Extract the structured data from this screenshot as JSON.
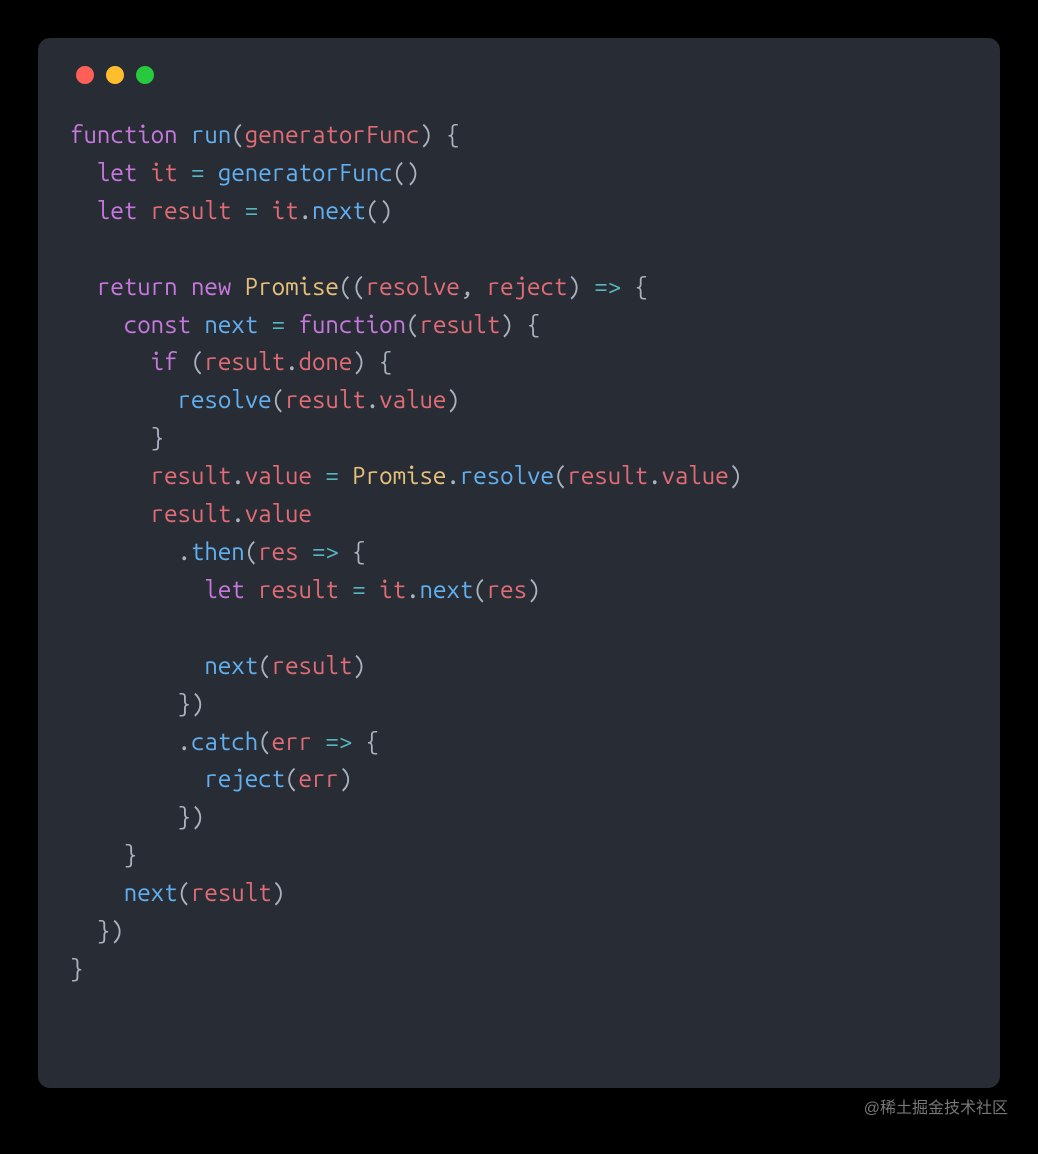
{
  "code": {
    "tokens": [
      [
        [
          "kw",
          "function"
        ],
        [
          "",
          ""
        ],
        [
          "",
          ""
        ],
        [
          "",
          ""
        ],
        [
          "",
          ""
        ],
        [
          "",
          ""
        ],
        [
          "",
          ""
        ],
        [
          "",
          ""
        ],
        [
          "",
          ""
        ],
        [
          "",
          ""
        ]
      ],
      []
    ],
    "raw_lines": [
      {
        "indent": 0,
        "segs": [
          [
            "kw",
            "function "
          ],
          [
            "fn",
            "run"
          ],
          [
            "punc",
            "("
          ],
          [
            "param",
            "generatorFunc"
          ],
          [
            "punc",
            ") {"
          ]
        ]
      },
      {
        "indent": 1,
        "segs": [
          [
            "kw",
            "let "
          ],
          [
            "var",
            "it"
          ],
          [
            "punc",
            " "
          ],
          [
            "op",
            "="
          ],
          [
            "punc",
            " "
          ],
          [
            "call",
            "generatorFunc"
          ],
          [
            "punc",
            "()"
          ]
        ]
      },
      {
        "indent": 1,
        "segs": [
          [
            "kw",
            "let "
          ],
          [
            "var",
            "result"
          ],
          [
            "punc",
            " "
          ],
          [
            "op",
            "="
          ],
          [
            "punc",
            " "
          ],
          [
            "var",
            "it"
          ],
          [
            "punc",
            "."
          ],
          [
            "method",
            "next"
          ],
          [
            "punc",
            "()"
          ]
        ]
      },
      {
        "indent": 0,
        "segs": [
          [
            "",
            ""
          ]
        ]
      },
      {
        "indent": 1,
        "segs": [
          [
            "kw",
            "return "
          ],
          [
            "kw",
            "new "
          ],
          [
            "cls",
            "Promise"
          ],
          [
            "punc",
            "(("
          ],
          [
            "param",
            "resolve"
          ],
          [
            "punc",
            ", "
          ],
          [
            "param",
            "reject"
          ],
          [
            "punc",
            ") "
          ],
          [
            "op",
            "=>"
          ],
          [
            "punc",
            " {"
          ]
        ]
      },
      {
        "indent": 2,
        "segs": [
          [
            "kw",
            "const "
          ],
          [
            "fn",
            "next"
          ],
          [
            "punc",
            " "
          ],
          [
            "op",
            "="
          ],
          [
            "punc",
            " "
          ],
          [
            "kw",
            "function"
          ],
          [
            "punc",
            "("
          ],
          [
            "param",
            "result"
          ],
          [
            "punc",
            ") {"
          ]
        ]
      },
      {
        "indent": 3,
        "segs": [
          [
            "kw",
            "if "
          ],
          [
            "punc",
            "("
          ],
          [
            "var",
            "result"
          ],
          [
            "punc",
            "."
          ],
          [
            "prop",
            "done"
          ],
          [
            "punc",
            ") {"
          ]
        ]
      },
      {
        "indent": 4,
        "segs": [
          [
            "call",
            "resolve"
          ],
          [
            "punc",
            "("
          ],
          [
            "var",
            "result"
          ],
          [
            "punc",
            "."
          ],
          [
            "prop",
            "value"
          ],
          [
            "punc",
            ")"
          ]
        ]
      },
      {
        "indent": 3,
        "segs": [
          [
            "punc",
            "}"
          ]
        ]
      },
      {
        "indent": 3,
        "segs": [
          [
            "var",
            "result"
          ],
          [
            "punc",
            "."
          ],
          [
            "prop",
            "value"
          ],
          [
            "punc",
            " "
          ],
          [
            "op",
            "="
          ],
          [
            "punc",
            " "
          ],
          [
            "cls",
            "Promise"
          ],
          [
            "punc",
            "."
          ],
          [
            "method",
            "resolve"
          ],
          [
            "punc",
            "("
          ],
          [
            "var",
            "result"
          ],
          [
            "punc",
            "."
          ],
          [
            "prop",
            "value"
          ],
          [
            "punc",
            ")"
          ]
        ]
      },
      {
        "indent": 3,
        "segs": [
          [
            "var",
            "result"
          ],
          [
            "punc",
            "."
          ],
          [
            "prop",
            "value"
          ]
        ]
      },
      {
        "indent": 4,
        "segs": [
          [
            "punc",
            "."
          ],
          [
            "method",
            "then"
          ],
          [
            "punc",
            "("
          ],
          [
            "param",
            "res"
          ],
          [
            "punc",
            " "
          ],
          [
            "op",
            "=>"
          ],
          [
            "punc",
            " {"
          ]
        ]
      },
      {
        "indent": 5,
        "segs": [
          [
            "kw",
            "let "
          ],
          [
            "var",
            "result"
          ],
          [
            "punc",
            " "
          ],
          [
            "op",
            "="
          ],
          [
            "punc",
            " "
          ],
          [
            "var",
            "it"
          ],
          [
            "punc",
            "."
          ],
          [
            "method",
            "next"
          ],
          [
            "punc",
            "("
          ],
          [
            "var",
            "res"
          ],
          [
            "punc",
            ")"
          ]
        ]
      },
      {
        "indent": 0,
        "segs": [
          [
            "",
            ""
          ]
        ]
      },
      {
        "indent": 5,
        "segs": [
          [
            "call",
            "next"
          ],
          [
            "punc",
            "("
          ],
          [
            "var",
            "result"
          ],
          [
            "punc",
            ")"
          ]
        ]
      },
      {
        "indent": 4,
        "segs": [
          [
            "punc",
            "})"
          ]
        ]
      },
      {
        "indent": 4,
        "segs": [
          [
            "punc",
            "."
          ],
          [
            "method",
            "catch"
          ],
          [
            "punc",
            "("
          ],
          [
            "param",
            "err"
          ],
          [
            "punc",
            " "
          ],
          [
            "op",
            "=>"
          ],
          [
            "punc",
            " {"
          ]
        ]
      },
      {
        "indent": 5,
        "segs": [
          [
            "call",
            "reject"
          ],
          [
            "punc",
            "("
          ],
          [
            "var",
            "err"
          ],
          [
            "punc",
            ")"
          ]
        ]
      },
      {
        "indent": 4,
        "segs": [
          [
            "punc",
            "})"
          ]
        ]
      },
      {
        "indent": 2,
        "segs": [
          [
            "punc",
            "}"
          ]
        ]
      },
      {
        "indent": 2,
        "segs": [
          [
            "call",
            "next"
          ],
          [
            "punc",
            "("
          ],
          [
            "var",
            "result"
          ],
          [
            "punc",
            ")"
          ]
        ]
      },
      {
        "indent": 1,
        "segs": [
          [
            "punc",
            "})"
          ]
        ]
      },
      {
        "indent": 0,
        "segs": [
          [
            "punc",
            "}"
          ]
        ]
      }
    ]
  },
  "watermark": "@稀土掘金技术社区",
  "colors": {
    "bg": "#000",
    "window": "#282c34",
    "red": "#ff5f56",
    "yellow": "#ffbd2e",
    "green": "#27c93f"
  }
}
